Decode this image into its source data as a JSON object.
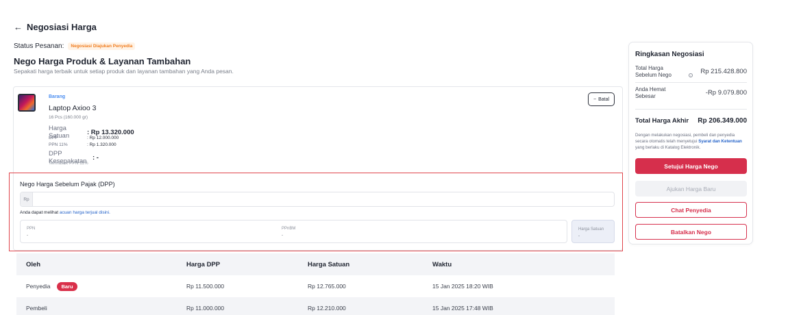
{
  "header": {
    "back_icon": "←",
    "title": "Negosiasi Harga"
  },
  "status": {
    "label": "Status Pesanan:",
    "badge": "Negosiasi Diajukan Penyedia",
    "badge_color": "#f07c1e"
  },
  "section": {
    "title": "Nego Harga Produk & Layanan Tambahan",
    "subtitle": "Sepakati harga terbaik untuk setiap produk dan layanan tambahan yang Anda pesan."
  },
  "product": {
    "category": "Barang",
    "name": "Laptop Axioo 3",
    "qty": "16 Pcs (160.000 gr)",
    "harga_satuan_label": "Harga Satuan",
    "harga_satuan_value": ": Rp 13.320.000",
    "dpp_label": "DPP",
    "dpp_value": ": Rp 12.000.000",
    "ppn_label": "PPN 11%",
    "ppn_value": ": Rp 1.320.000",
    "kesepakatan_label": "DPP Kesepakatan",
    "kesepakatan_value": ": -",
    "note": "Termasuk PPN 11%",
    "batal_icon": "−",
    "batal_label": "Batal"
  },
  "nego": {
    "label": "Nego Harga Sebelum Pajak (DPP)",
    "prefix": "Rp",
    "value": "",
    "acuan_text": "Anda dapat melihat ",
    "acuan_link": "acuan harga terjual disini.",
    "ppn_label": "PPN",
    "ppn_value": "-",
    "ppnbm_label": "PPnBM",
    "ppnbm_value": "-",
    "harga_satuan_label": "Harga Satuan",
    "harga_satuan_value": "-"
  },
  "history": {
    "headers": [
      "Oleh",
      "Harga DPP",
      "Harga Satuan",
      "Waktu"
    ],
    "rows": [
      {
        "oleh": "Penyedia",
        "badge": "Baru",
        "dpp": "Rp 11.500.000",
        "satuan": "Rp 12.765.000",
        "waktu": "15 Jan 2025 18:20 WIB"
      },
      {
        "oleh": "Pembeli",
        "badge": "",
        "dpp": "Rp 11.000.000",
        "satuan": "Rp 12.210.000",
        "waktu": "15 Jan 2025 17:48 WIB"
      }
    ]
  },
  "summary": {
    "title": "Ringkasan Negosiasi",
    "total_sebelum_label": "Total Harga Sebelum Nego",
    "total_sebelum_value": "Rp 215.428.800",
    "info_icon": "i",
    "hemat_label": "Anda Hemat Sebesar",
    "hemat_value": "-Rp 9.079.800",
    "akhir_label": "Total Harga Akhir",
    "akhir_value": "Rp 206.349.000",
    "note_text": "Dengan melakukan negosiasi, pembeli dan penyedia secara otomatis telah menyetujui ",
    "note_link": "Syarat dan Ketentuan",
    "note_suffix": " yang berlaku di Katalog Elektronik.",
    "btn_setujui": "Setujui Harga Nego",
    "btn_ajukan": "Ajukan Harga Baru",
    "btn_chat": "Chat Penyedia",
    "btn_batalkan": "Batalkan Nego"
  },
  "colors": {
    "primary": "#d62f4c",
    "link": "#2563c9",
    "highlight_border": "#e0444b"
  }
}
